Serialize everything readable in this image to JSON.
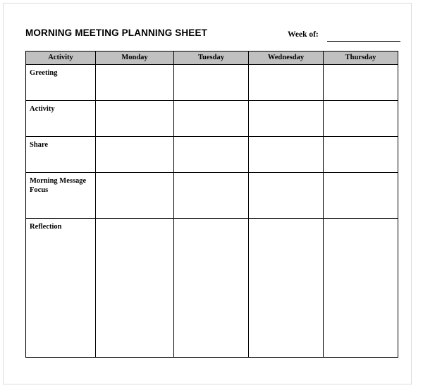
{
  "document": {
    "title": "MORNING MEETING PLANNING SHEET",
    "week_of_label": "Week of:",
    "week_of_value": ""
  },
  "table": {
    "columns": [
      {
        "key": "activity",
        "label": "Activity"
      },
      {
        "key": "monday",
        "label": "Monday"
      },
      {
        "key": "tuesday",
        "label": "Tuesday"
      },
      {
        "key": "wednesday",
        "label": "Wednesday"
      },
      {
        "key": "thursday",
        "label": "Thursday"
      }
    ],
    "rows": [
      {
        "label": "Greeting",
        "monday": "",
        "tuesday": "",
        "wednesday": "",
        "thursday": ""
      },
      {
        "label": "Activity",
        "monday": "",
        "tuesday": "",
        "wednesday": "",
        "thursday": ""
      },
      {
        "label": "Share",
        "monday": "",
        "tuesday": "",
        "wednesday": "",
        "thursday": ""
      },
      {
        "label": "Morning Message Focus",
        "monday": "",
        "tuesday": "",
        "wednesday": "",
        "thursday": ""
      },
      {
        "label": "Reflection",
        "monday": "",
        "tuesday": "",
        "wednesday": "",
        "thursday": ""
      }
    ]
  },
  "colors": {
    "header_fill": "#c0c0c0",
    "border": "#000000",
    "page_border": "#dcdcdc",
    "text": "#000000",
    "page_background": "#ffffff"
  }
}
